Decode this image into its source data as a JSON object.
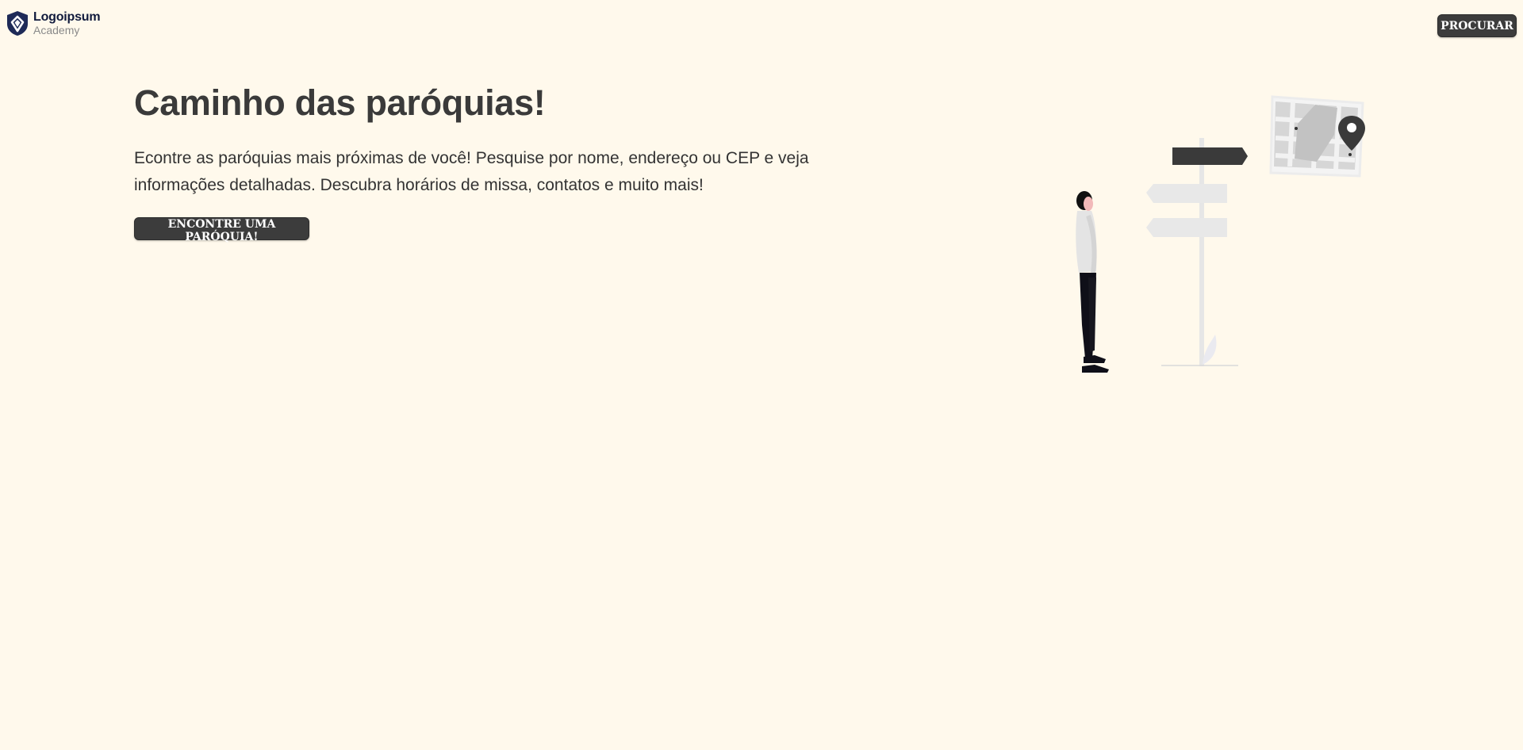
{
  "header": {
    "logo": {
      "name": "Logoipsum",
      "subtitle": "Academy",
      "icon": "shield-logo-icon",
      "color": "#1e2a57"
    },
    "search_button_label": "PROCURAR"
  },
  "hero": {
    "title": "Caminho das paróquias!",
    "description": "Econtre as paróquias mais próximas de você! Pesquise por nome, endereço ou CEP e veja informações detalhadas. Descubra horários de missa, contatos e muito mais!",
    "cta_label": "ENCONTRE UMA PARÓQUIA!"
  },
  "illustration": {
    "icon": "signpost-map-person-illustration"
  },
  "colors": {
    "background": "#fff9ec",
    "text": "#3a3a3a",
    "button": "#3c3c3c",
    "button_text": "#ffffff"
  }
}
